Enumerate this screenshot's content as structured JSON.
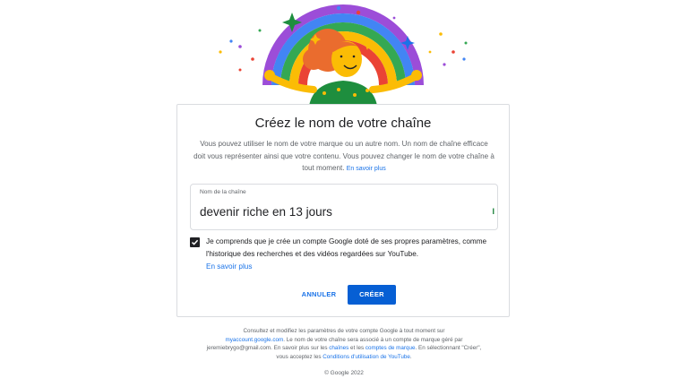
{
  "dialog": {
    "title": "Créez le nom de votre chaîne",
    "description": "Vous pouvez utiliser le nom de votre marque ou un autre nom. Un nom de chaîne efficace doit vous représenter ainsi que votre contenu. Vous pouvez changer le nom de votre chaîne à tout moment.",
    "learn_more": "En savoir plus",
    "field": {
      "label": "Nom de la chaîne",
      "value": "devenir riche en 13 jours",
      "counter": "1​|"
    },
    "consent": {
      "checked": true,
      "text": "Je comprends que je crée un compte Google doté de ses propres paramètres, comme l'historique des recherches et des vidéos regardées sur YouTube.",
      "learn_more": "En savoir plus"
    },
    "cancel_label": "ANNULER",
    "create_label": "CRÉER"
  },
  "footer": {
    "p1": "Consultez et modifiez les paramètres de votre compte Google à tout moment sur",
    "link_account": "myaccount.google.com",
    "p2": ". Le nom de votre chaîne sera associé à un compte de marque géré par jeremiebrygo@gmail.com. En savoir plus sur les ",
    "link_channels": "chaînes",
    "p3": " et les ",
    "link_brand": "comptes de marque",
    "p4": ". En sélectionnant \"Créer\", vous acceptez les ",
    "link_terms": "Conditions d'utilisation de YouTube",
    "p5": ".",
    "copyright": "© Google 2022"
  },
  "colors": {
    "primary_blue": "#065fd4",
    "link_blue": "#1a73e8",
    "border": "#dadce0",
    "text_secondary": "#5f6368"
  },
  "illustration": "rainbow-celebration-illustration"
}
